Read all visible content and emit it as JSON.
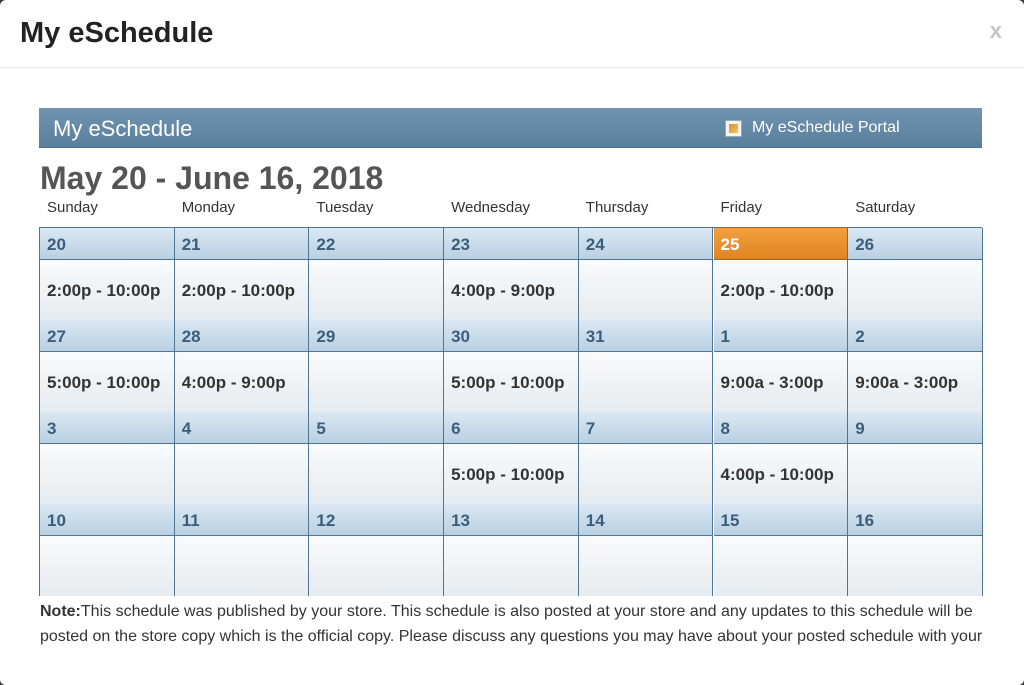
{
  "modal": {
    "title": "My eSchedule",
    "close_label": "x"
  },
  "banner": {
    "title": "My eSchedule",
    "portal_label": "My eSchedule Portal",
    "portal_icon": "external-link-icon"
  },
  "date_range": "May 20 - June 16, 2018",
  "days_of_week": [
    "Sunday",
    "Monday",
    "Tuesday",
    "Wednesday",
    "Thursday",
    "Friday",
    "Saturday"
  ],
  "colors": {
    "header_blue": "#5a7f9c",
    "today_orange": "#e08420",
    "grid_border": "#4f7593"
  },
  "weeks": [
    [
      {
        "date": "20",
        "shift": "2:00p - 10:00p"
      },
      {
        "date": "21",
        "shift": "2:00p - 10:00p"
      },
      {
        "date": "22",
        "shift": ""
      },
      {
        "date": "23",
        "shift": "4:00p - 9:00p"
      },
      {
        "date": "24",
        "shift": ""
      },
      {
        "date": "25",
        "shift": "2:00p - 10:00p",
        "today": true
      },
      {
        "date": "26",
        "shift": ""
      }
    ],
    [
      {
        "date": "27",
        "shift": "5:00p - 10:00p"
      },
      {
        "date": "28",
        "shift": "4:00p - 9:00p"
      },
      {
        "date": "29",
        "shift": ""
      },
      {
        "date": "30",
        "shift": "5:00p - 10:00p"
      },
      {
        "date": "31",
        "shift": ""
      },
      {
        "date": "1",
        "shift": "9:00a - 3:00p"
      },
      {
        "date": "2",
        "shift": "9:00a - 3:00p"
      }
    ],
    [
      {
        "date": "3",
        "shift": ""
      },
      {
        "date": "4",
        "shift": ""
      },
      {
        "date": "5",
        "shift": ""
      },
      {
        "date": "6",
        "shift": "5:00p - 10:00p"
      },
      {
        "date": "7",
        "shift": ""
      },
      {
        "date": "8",
        "shift": "4:00p - 10:00p"
      },
      {
        "date": "9",
        "shift": ""
      }
    ],
    [
      {
        "date": "10",
        "shift": ""
      },
      {
        "date": "11",
        "shift": ""
      },
      {
        "date": "12",
        "shift": ""
      },
      {
        "date": "13",
        "shift": ""
      },
      {
        "date": "14",
        "shift": ""
      },
      {
        "date": "15",
        "shift": ""
      },
      {
        "date": "16",
        "shift": ""
      }
    ]
  ],
  "note": {
    "label": "Note:",
    "text": "This schedule was published by your store. This schedule is also posted at your store and any updates to this schedule will be posted on the store copy which is the official copy. Please discuss any questions you may have about your posted schedule with your manager. Thank you."
  }
}
